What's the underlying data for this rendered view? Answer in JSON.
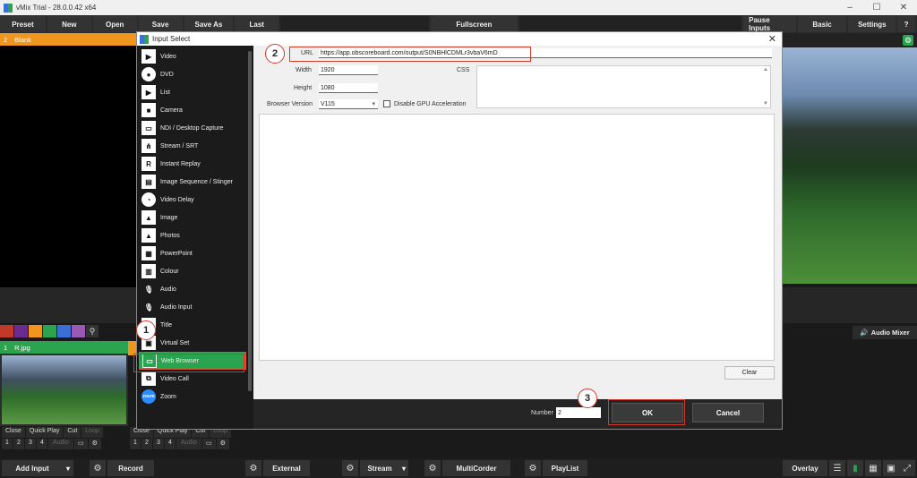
{
  "window": {
    "title": "vMix Trial - 28.0.0.42 x64"
  },
  "toolbar": {
    "preset": "Preset",
    "new": "New",
    "open": "Open",
    "save": "Save",
    "save_as": "Save As",
    "last": "Last",
    "fullscreen": "Fullscreen",
    "pause_inputs": "Pause Inputs",
    "basic": "Basic",
    "settings": "Settings",
    "help": "?"
  },
  "preset_row": {
    "number": "2",
    "label": "Blank"
  },
  "swatch_colors": [
    "#c0392b",
    "#6b2c8f",
    "#f0961e",
    "#2aa44f",
    "#3a6fd8",
    "#9b59b6"
  ],
  "input1": {
    "number": "1",
    "name": "R.jpg"
  },
  "audio_mixer": "Audio Mixer",
  "input_controls": [
    "Close",
    "Quick Play",
    "Cut",
    "Loop"
  ],
  "input_numbers": [
    "1",
    "2",
    "3",
    "4",
    "Audio"
  ],
  "bottombar": {
    "add_input": "Add Input",
    "record": "Record",
    "external": "External",
    "stream": "Stream",
    "multicorder": "MultiCorder",
    "playlist": "PlayList",
    "overlay": "Overlay"
  },
  "dialog": {
    "title": "Input Select",
    "input_types": [
      {
        "label": "Video",
        "icon": "video-icon"
      },
      {
        "label": "DVD",
        "icon": "dvd-icon"
      },
      {
        "label": "List",
        "icon": "list-icon"
      },
      {
        "label": "Camera",
        "icon": "camera-icon"
      },
      {
        "label": "NDI / Desktop Capture",
        "icon": "monitor-icon"
      },
      {
        "label": "Stream / SRT",
        "icon": "antenna-icon"
      },
      {
        "label": "Instant Replay",
        "icon": "replay-icon"
      },
      {
        "label": "Image Sequence / Stinger",
        "icon": "image-sequence-icon"
      },
      {
        "label": "Video Delay",
        "icon": "clock-icon"
      },
      {
        "label": "Image",
        "icon": "image-icon"
      },
      {
        "label": "Photos",
        "icon": "photos-icon"
      },
      {
        "label": "PowerPoint",
        "icon": "powerpoint-icon"
      },
      {
        "label": "Colour",
        "icon": "colour-icon"
      },
      {
        "label": "Audio",
        "icon": "microphone-icon"
      },
      {
        "label": "Audio Input",
        "icon": "microphone-icon"
      },
      {
        "label": "Title",
        "icon": "title-icon"
      },
      {
        "label": "Virtual Set",
        "icon": "virtual-set-icon"
      },
      {
        "label": "Web Browser",
        "icon": "web-browser-icon"
      },
      {
        "label": "Video Call",
        "icon": "video-call-icon"
      },
      {
        "label": "Zoom",
        "icon": "zoom-icon"
      }
    ],
    "selected_type": "Web Browser",
    "url_label": "URL",
    "url_value": "https://app.obscoreboard.com/output/S0NBHlCDMLr3vbaV6mD",
    "width_label": "Width",
    "width_value": "1920",
    "height_label": "Height",
    "height_value": "1080",
    "css_label": "CSS",
    "browser_version_label": "Browser Version",
    "browser_version_value": "V115",
    "disable_gpu_label": "Disable GPU Acceleration",
    "clear": "Clear",
    "number_label": "Number",
    "number_value": "2",
    "ok": "OK",
    "cancel": "Cancel"
  },
  "annotations": {
    "step1": "1",
    "step2": "2",
    "step3": "3"
  }
}
